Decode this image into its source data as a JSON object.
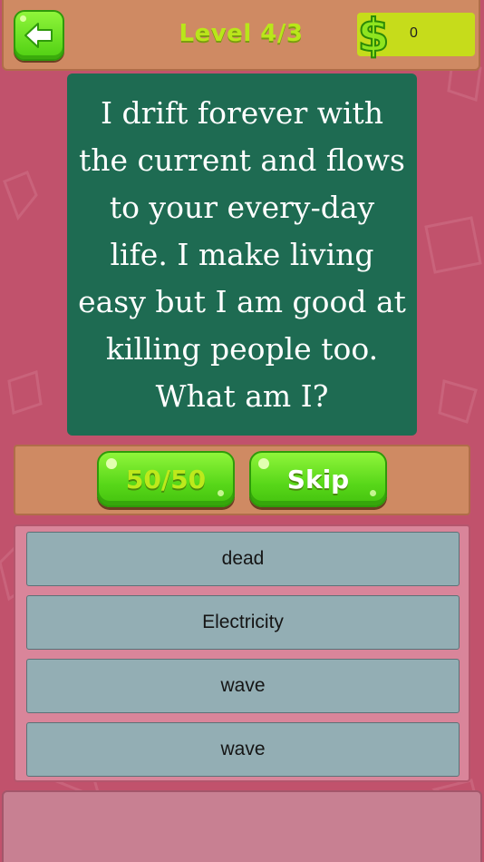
{
  "header": {
    "back_icon": "back-arrow-icon",
    "level_title": "Level 4/3",
    "coin_icon": "dollar-icon",
    "coin_value": "0"
  },
  "question": {
    "text": "I drift forever with the current and flows to your every-day life. I make living easy but I am good at killing people too. What am I?"
  },
  "actions": {
    "fifty_fifty_label": "50/50",
    "skip_label": "Skip"
  },
  "answers": [
    {
      "label": "dead"
    },
    {
      "label": "Electricity"
    },
    {
      "label": "wave"
    },
    {
      "label": "wave"
    }
  ],
  "colors": {
    "background": "#c1526c",
    "panel": "#cf8a63",
    "question_card": "#1e6b52",
    "button_green": "#58d719",
    "answer_bg": "#93aeb4"
  }
}
